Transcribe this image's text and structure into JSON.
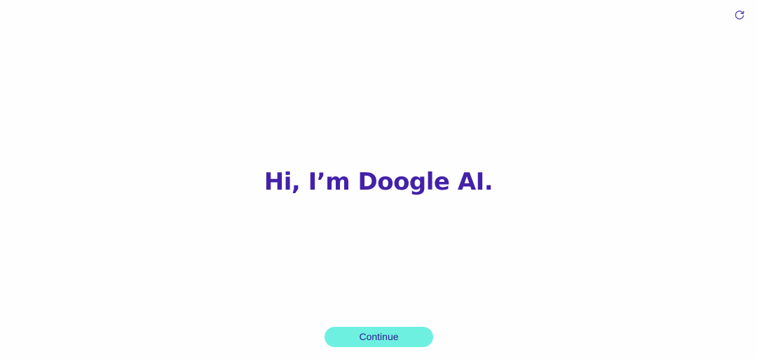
{
  "header": {
    "refresh_icon": "refresh-icon"
  },
  "main": {
    "greeting": "Hi, I’m Doogle AI."
  },
  "footer": {
    "continue_label": "Continue"
  },
  "colors": {
    "brand_purple": "#4322a9",
    "button_teal": "#6ef0e0",
    "button_text": "#2c1a8e",
    "background": "#fefefe"
  }
}
